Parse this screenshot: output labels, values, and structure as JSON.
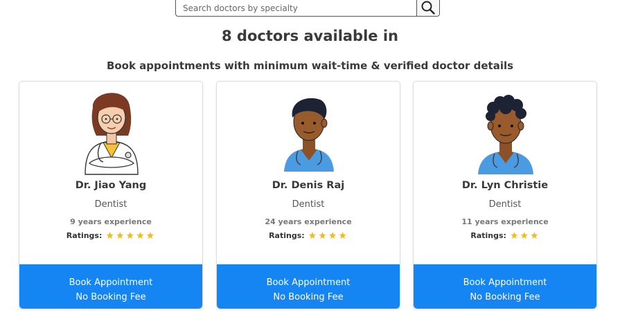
{
  "search": {
    "placeholder": "Search doctors by specialty"
  },
  "heading": "8 doctors available in",
  "subheading": "Book appointments with minimum wait-time & verified doctor details",
  "ratings_label": "Ratings:",
  "star_color": "#f5b914",
  "button_color": "#1585f3",
  "doctors": [
    {
      "name": "Dr. Jiao Yang",
      "specialty": "Dentist",
      "experience": "9 years experience",
      "stars": 5,
      "button_line1": "Book Appointment",
      "button_line2": "No Booking Fee"
    },
    {
      "name": "Dr. Denis Raj",
      "specialty": "Dentist",
      "experience": "24 years experience",
      "stars": 4,
      "button_line1": "Book Appointment",
      "button_line2": "No Booking Fee"
    },
    {
      "name": "Dr. Lyn Christie",
      "specialty": "Dentist",
      "experience": "11 years experience",
      "stars": 3,
      "button_line1": "Book Appointment",
      "button_line2": "No Booking Fee"
    }
  ]
}
